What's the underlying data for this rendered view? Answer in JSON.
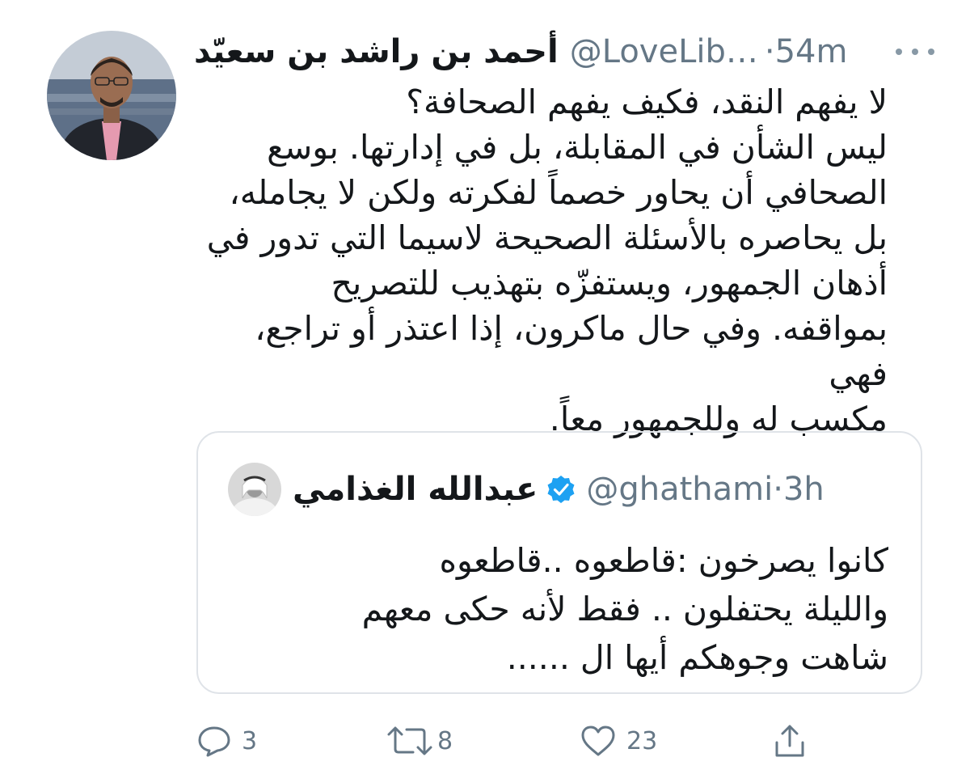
{
  "author": {
    "display_name": "أحمد بن راشد بن سعيّد",
    "handle": "@LoveLib…",
    "separator": " · ",
    "time": "54m"
  },
  "tweet": {
    "lines": [
      "لا يفهم النقد، فكيف يفهم الصحافة؟",
      "ليس الشأن في المقابلة، بل في إدارتها. بوسع",
      "الصحافي أن يحاور خصماً لفكرته ولكن لا يجامله،",
      "بل يحاصره بالأسئلة الصحيحة لاسيما التي تدور في",
      "أذهان الجمهور، ويستفزّه بتهذيب للتصريح",
      "بمواقفه. وفي حال ماكرون، إذا اعتذر أو تراجع، فهي",
      "مكسب له وللجمهور معاً."
    ]
  },
  "quoted": {
    "display_name": "عبدالله الغذامي",
    "handle": "@ghathami",
    "separator": " · ",
    "time": "3h",
    "lines": [
      "كانوا يصرخون :قاطعوه ..قاطعوه",
      "والليلة يحتفلون .. فقط لأنه حكى معهم",
      "شاهت وجوهكم أيها ال ......"
    ]
  },
  "actions": {
    "reply_count": "3",
    "retweet_count": "8",
    "like_count": "23"
  },
  "icons": {
    "more": "more-horizontal-icon",
    "verified": "verified-badge-icon",
    "reply": "reply-icon",
    "retweet": "retweet-icon",
    "like": "heart-icon",
    "share": "share-icon"
  },
  "colors": {
    "text": "#14171a",
    "secondary": "#657786",
    "verified": "#1da1f2",
    "border": "#dfe3e8"
  }
}
